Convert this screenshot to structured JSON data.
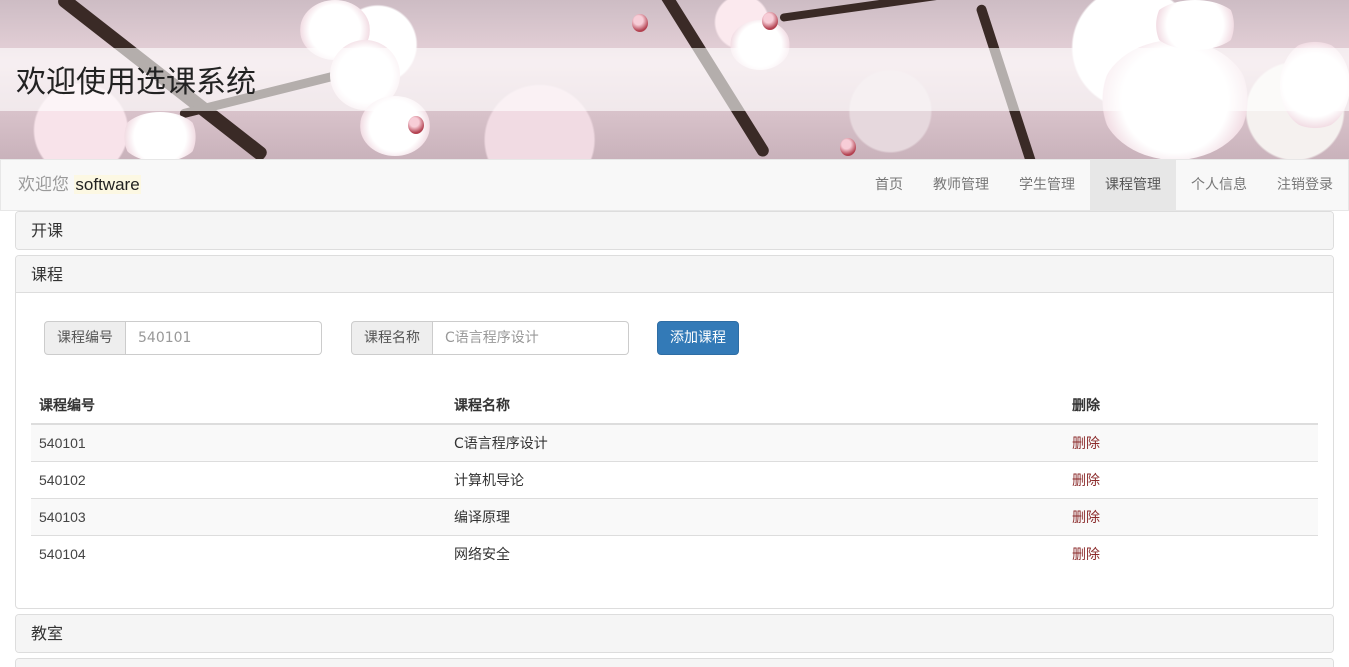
{
  "banner": {
    "title": "欢迎使用选课系统"
  },
  "navbar": {
    "welcome": "欢迎您",
    "username": "software",
    "links": [
      {
        "label": "首页",
        "active": false
      },
      {
        "label": "教师管理",
        "active": false
      },
      {
        "label": "学生管理",
        "active": false
      },
      {
        "label": "课程管理",
        "active": true
      },
      {
        "label": "个人信息",
        "active": false
      },
      {
        "label": "注销登录",
        "active": false
      }
    ]
  },
  "panels": {
    "open_course": {
      "title": "开课"
    },
    "course": {
      "title": "课程",
      "form": {
        "code_label": "课程编号",
        "code_placeholder": "540101",
        "name_label": "课程名称",
        "name_placeholder": "C语言程序设计",
        "add_button": "添加课程"
      },
      "table": {
        "headers": [
          "课程编号",
          "课程名称",
          "删除"
        ],
        "rows": [
          {
            "code": "540101",
            "name": "C语言程序设计",
            "action": "删除"
          },
          {
            "code": "540102",
            "name": "计算机导论",
            "action": "删除"
          },
          {
            "code": "540103",
            "name": "编译原理",
            "action": "删除"
          },
          {
            "code": "540104",
            "name": "网络安全",
            "action": "删除"
          }
        ]
      }
    },
    "classroom": {
      "title": "教室"
    }
  },
  "colors": {
    "primary": "#337ab7",
    "delete_link": "#8b2b2b",
    "nav_active_bg": "#e7e7e7"
  }
}
